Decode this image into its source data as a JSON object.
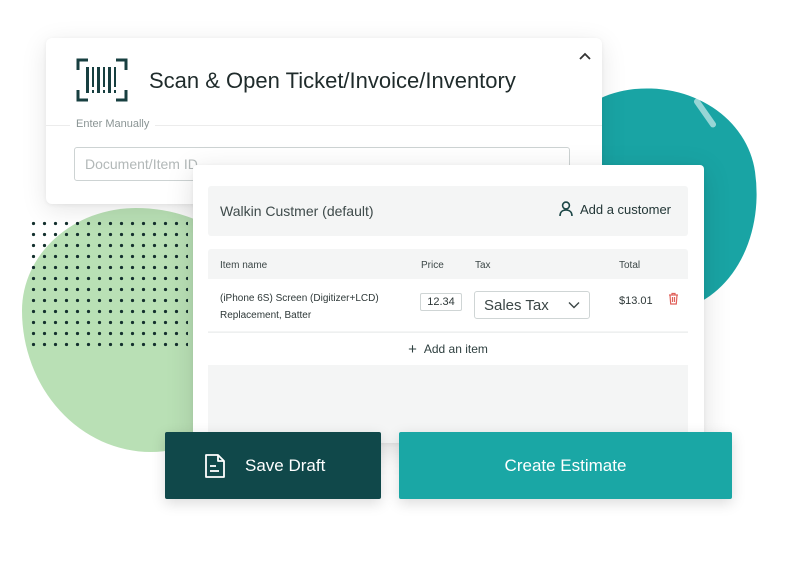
{
  "scan": {
    "title": "Scan & Open Ticket/Invoice/Inventory",
    "enter_manually_label": "Enter Manually",
    "input_placeholder": "Document/Item ID",
    "input_value": ""
  },
  "estimate": {
    "customer_name": "Walkin Custmer (default)",
    "add_customer_label": "Add a customer",
    "columns": {
      "item_name": "Item name",
      "price": "Price",
      "tax": "Tax",
      "total": "Total"
    },
    "items": [
      {
        "name": "(iPhone 6S) Screen (Digitizer+LCD) Replacement, Batter",
        "price": "12.34",
        "tax": "Sales Tax",
        "total": "$13.01"
      }
    ],
    "add_item_label": "Add an item"
  },
  "actions": {
    "save_draft_label": "Save Draft",
    "create_estimate_label": "Create Estimate"
  },
  "colors": {
    "dark_teal": "#10484a",
    "accent_teal": "#1aa7a5",
    "green_blob": "#b9e0b5",
    "delete_red": "#e0605a"
  },
  "icons": [
    "barcode-icon",
    "chevron-up-icon",
    "user-icon",
    "plus-icon",
    "chevron-down-icon",
    "trash-icon",
    "document-icon"
  ]
}
